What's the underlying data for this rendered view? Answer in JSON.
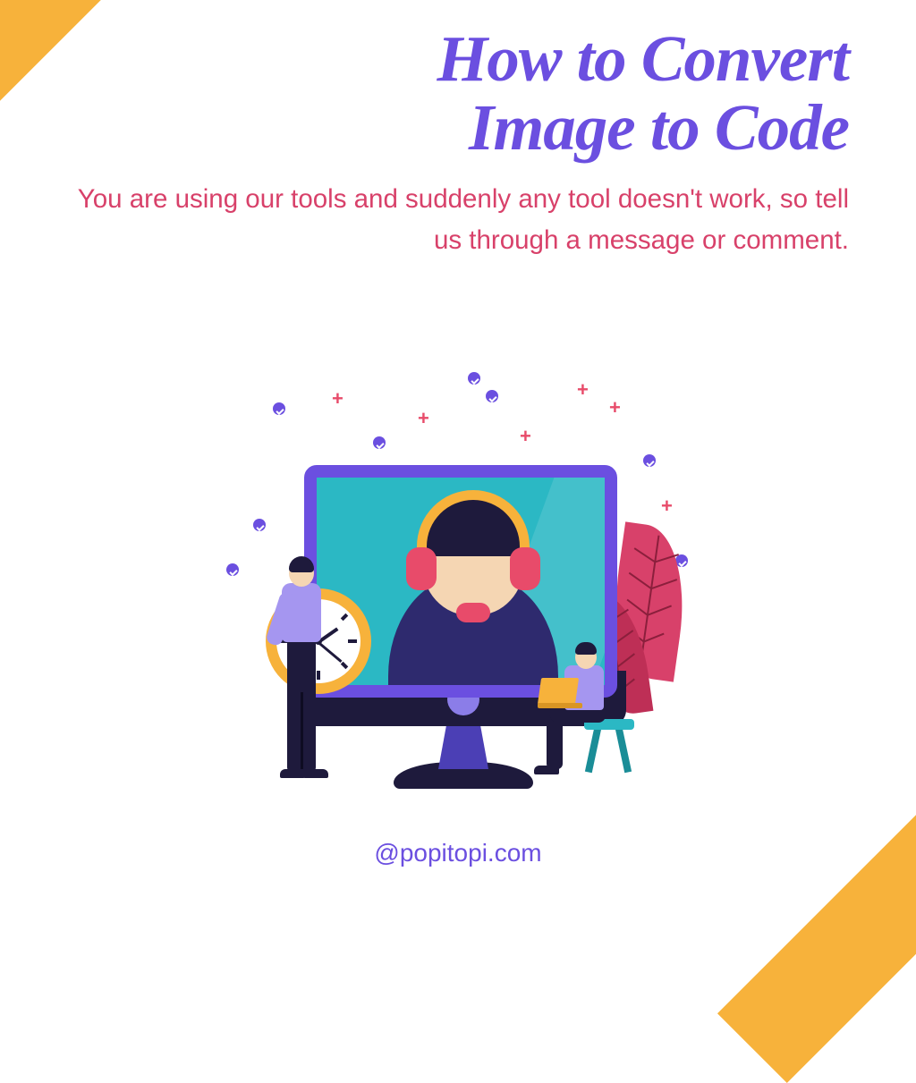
{
  "title_line1": "How to Convert",
  "title_line2": "Image to Code",
  "subtitle": "You are using our tools and suddenly any tool doesn't work, so tell us through a message or comment.",
  "footer_handle": "@popitopi.com",
  "colors": {
    "accent_orange": "#f7b23b",
    "title_purple": "#6b4fe0",
    "subtitle_pink": "#d8416a",
    "screen_teal": "#2bb8c4",
    "dark_navy": "#1e1a3c",
    "headset_red": "#e84b6a"
  }
}
